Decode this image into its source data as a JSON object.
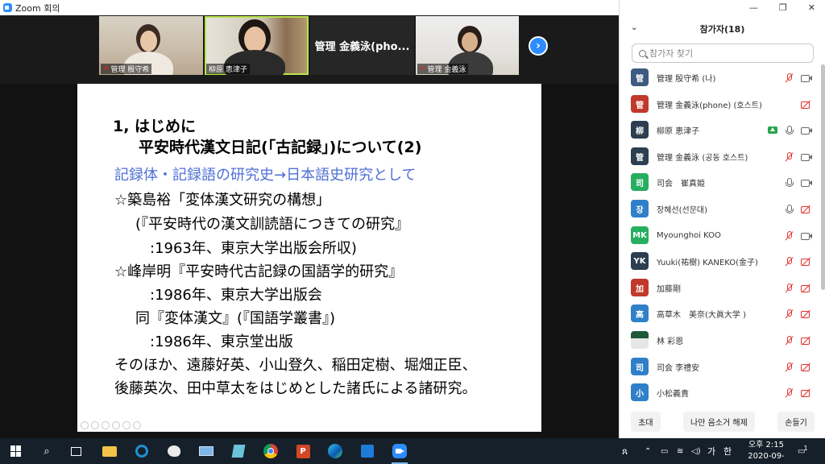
{
  "window": {
    "title": "Zoom 회의"
  },
  "videos": [
    {
      "name": "管理 殷守希",
      "muted": true
    },
    {
      "name": "柳原 恵津子",
      "muted": false
    },
    {
      "name": "管理 金義泳(pho...",
      "muted": false
    },
    {
      "name": "管理 金義泳",
      "muted": true
    }
  ],
  "next_glyph": "›",
  "slide": {
    "lines": [
      "1, はじめに",
      "平安時代漢文日記(「古記録」)について(2)",
      "記録体・記録語の研究史→日本語史研究として",
      "☆築島裕「変体漢文研究の構想」",
      "(『平安時代の漢文訓読語につきての研究』",
      ":1963年、東京大学出版会所収)",
      "☆峰岸明『平安時代古記録の国語学的研究』",
      ":1986年、東京大学出版会",
      "同『変体漢文』(『国語学叢書』)",
      ":1986年、東京堂出版",
      "そのほか、遠藤好英、小山登久、稲田定樹、堀畑正臣、",
      "後藤英次、田中草太をはじめとした諸氏による諸研究。"
    ]
  },
  "panel": {
    "title": "참가자(18)",
    "search_placeholder": "참가자 찾기",
    "participants": [
      {
        "avatar": "管",
        "name": "管理 殷守希 (나)",
        "color": "#3d5a80",
        "mic": "off",
        "cam": "on"
      },
      {
        "avatar": "管",
        "name": "管理 金義泳(phone) (호스트)",
        "color": "#c0392b",
        "mic": "none",
        "cam": "off"
      },
      {
        "avatar": "柳",
        "name": "柳原 恵津子",
        "color": "#2c3e50",
        "mic": "on",
        "cam": "on",
        "sharing": true
      },
      {
        "avatar": "管",
        "name": "管理 金義泳 (공동 호스트)",
        "color": "#2c3e50",
        "mic": "off",
        "cam": "on"
      },
      {
        "avatar": "司",
        "name": "司会　崔真姫",
        "color": "#27ae60",
        "mic": "on",
        "cam": "on"
      },
      {
        "avatar": "장",
        "name": "장혜선(선문대)",
        "color": "#2f80c8",
        "mic": "on",
        "cam": "off"
      },
      {
        "avatar": "MK",
        "name": "Myounghoi KOO",
        "color": "#27ae60",
        "mic": "off",
        "cam": "on"
      },
      {
        "avatar": "YK",
        "name": "Yuuki(祐樹) KANEKO(金子)",
        "color": "#2c3e50",
        "mic": "off",
        "cam": "off"
      },
      {
        "avatar": "加",
        "name": "加藤剛",
        "color": "#c0392b",
        "mic": "off",
        "cam": "off"
      },
      {
        "avatar": "高",
        "name": "高草木　美奈(大眞大学 )",
        "color": "#2f80c8",
        "mic": "off",
        "cam": "off"
      },
      {
        "avatar": "",
        "name": "林 彩恩",
        "color": "#1e5a3a",
        "mic": "off",
        "cam": "off",
        "photo": true
      },
      {
        "avatar": "司",
        "name": "司会 李禮安",
        "color": "#2f80c8",
        "mic": "off",
        "cam": "off"
      },
      {
        "avatar": "小",
        "name": "小松義貴",
        "color": "#2f80c8",
        "mic": "off",
        "cam": "off"
      }
    ],
    "footer": {
      "invite": "초대",
      "unmute_me": "나만 음소거 해제",
      "raise_hand": "손들기"
    }
  },
  "taskbar": {
    "clock_time": "오후 2:15",
    "clock_date": "2020-09-19",
    "ime_label": "가",
    "ime_label2": "한",
    "notification_count": "1"
  }
}
